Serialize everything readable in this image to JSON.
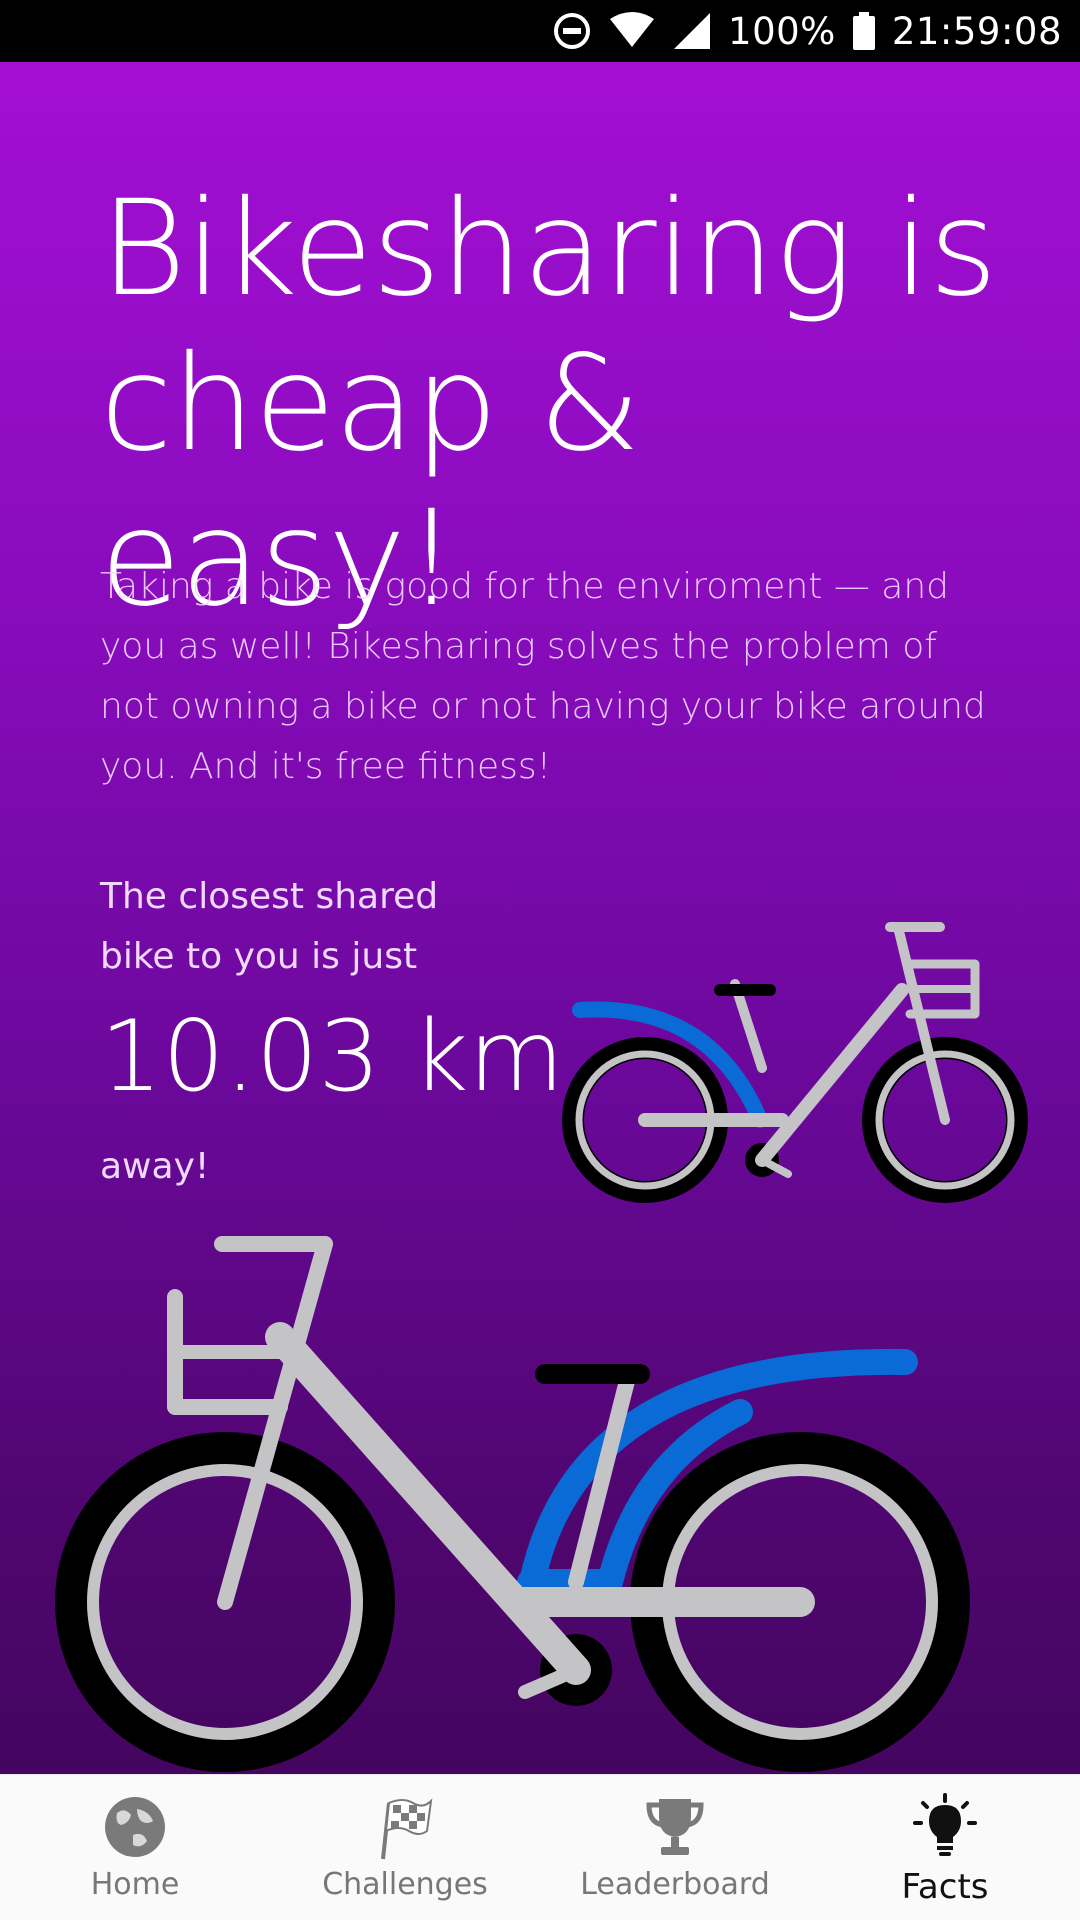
{
  "status_bar": {
    "battery": "100%",
    "time": "21:59:08",
    "icons": [
      "do-not-disturb-icon",
      "wifi-icon",
      "cell-signal-icon",
      "battery-icon"
    ]
  },
  "main": {
    "headline": "Bikesharing is cheap & easy!",
    "description": "Taking a bike is good for the enviroment — and you as well! Bikesharing solves the problem of not owning a bike or not having your bike around you. And it's free fitness!",
    "closest_prefix": "The closest shared bike to you is just",
    "distance": "10.03 km",
    "closest_suffix": "away!",
    "illustrations": [
      "bike-illustration-small",
      "bike-illustration-large"
    ]
  },
  "colors": {
    "gradient_top": "#a30fd3",
    "gradient_bottom": "#440560",
    "bike_frame": "#c4c4c6",
    "bike_fender": "#0a6ad6",
    "bike_tire": "#000000",
    "nav_background": "#fafafa"
  },
  "bottom_nav": {
    "items": [
      {
        "label": "Home",
        "icon": "globe-icon"
      },
      {
        "label": "Challenges",
        "icon": "checkered-flag-icon"
      },
      {
        "label": "Leaderboard",
        "icon": "trophy-icon"
      },
      {
        "label": "Facts",
        "icon": "lightbulb-icon",
        "active": true
      }
    ]
  }
}
